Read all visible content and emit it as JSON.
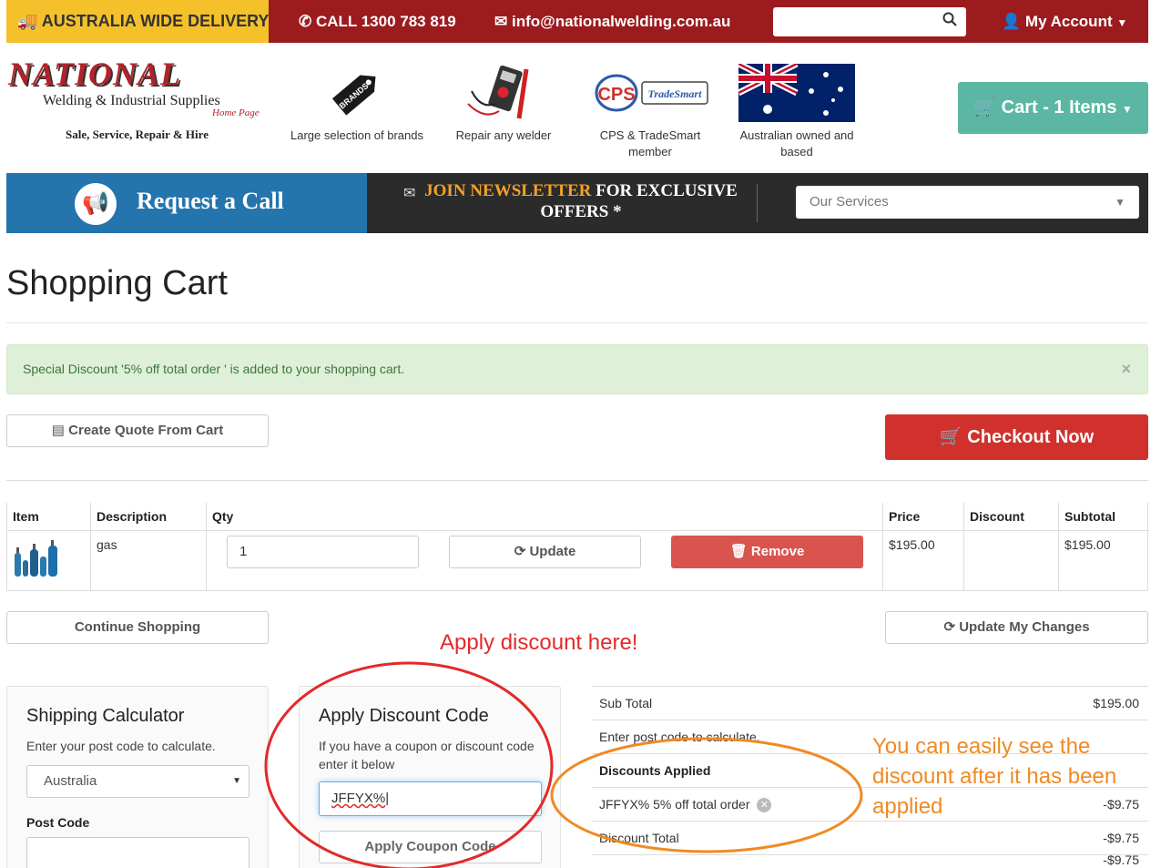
{
  "topbar": {
    "delivery": "AUSTRALIA WIDE DELIVERY",
    "phone": "CALL 1300 783 819",
    "email": "info@nationalwelding.com.au",
    "search_placeholder": "",
    "account": "My Account"
  },
  "header": {
    "logo": {
      "word": "NATIONAL",
      "sub": "Welding & Industrial Supplies",
      "home": "Home Page",
      "tagline": "Sale, Service, Repair & Hire"
    },
    "features": [
      {
        "label": "Large selection of brands",
        "icon": "brands-tag-icon",
        "badge": "BRANDS"
      },
      {
        "label": "Repair any welder",
        "icon": "multimeter-icon"
      },
      {
        "label": "CPS & TradeSmart member",
        "icon": "cps-tradesmart-logo",
        "logo_text": "CPS",
        "logo_text2": "TradeSmart"
      },
      {
        "label": "Australian owned and based",
        "icon": "australian-flag-icon"
      }
    ],
    "cart": "Cart - 1 Items"
  },
  "band": {
    "request_call": "Request a Call",
    "newsletter_hl": "JOIN NEWSLETTER",
    "newsletter_rest": " FOR EXCLUSIVE OFFERS *",
    "services_placeholder": "Our Services"
  },
  "cart_page": {
    "title": "Shopping Cart",
    "alert": "Special Discount '5% off total order ' is added to your shopping cart.",
    "alert_close": "×",
    "quote_button": "Create Quote From Cart",
    "checkout_button": "Checkout Now",
    "table": {
      "headers": [
        "Item",
        "Description",
        "Qty",
        "Price",
        "Discount",
        "Subtotal"
      ],
      "rows": [
        {
          "description": "gas",
          "qty": "1",
          "price": "$195.00",
          "discount": "",
          "subtotal": "$195.00"
        }
      ],
      "update_button": "Update",
      "remove_button": "Remove"
    },
    "continue_button": "Continue Shopping",
    "update_changes_button": "Update My Changes",
    "shipping": {
      "title": "Shipping Calculator",
      "text": "Enter your post code to calculate.",
      "country": "Australia",
      "postcode_label": "Post Code",
      "postcode_value": ""
    },
    "discount": {
      "title": "Apply Discount Code",
      "text": "If you have a coupon or discount code enter it below",
      "code": "JFFYX%",
      "button": "Apply Coupon Code"
    },
    "totals": {
      "subtotal_label": "Sub Total",
      "subtotal_value": "$195.00",
      "postcode_text": "Enter post code to calculate.",
      "discounts_heading": "Discounts Applied",
      "discount_line_label": "JFFYX% 5% off total order",
      "discount_line_value": "-$9.75",
      "discount_total_label": "Discount Total",
      "discount_total_value": "-$9.75",
      "last_value": "-$9.75"
    }
  },
  "annotations": {
    "red": "Apply discount here!",
    "orange": "You can easily see the discount after it has been applied",
    "red_color": "#e22a2a",
    "orange_color": "#f08a24"
  }
}
